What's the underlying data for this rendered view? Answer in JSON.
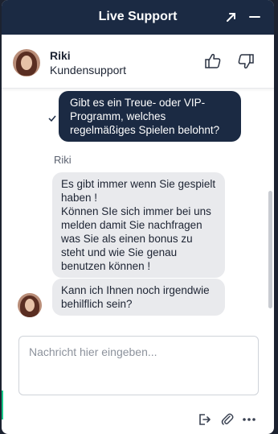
{
  "window": {
    "title": "Live Support",
    "popout_icon": "arrow-up-right-icon",
    "minimize_icon": "minimize-icon"
  },
  "agent": {
    "name": "Riki",
    "role": "Kundensupport",
    "thumbs_up_icon": "thumbs-up-icon",
    "thumbs_down_icon": "thumbs-down-icon"
  },
  "conversation": {
    "user_message": "Gibt es ein Treue- oder VIP-Programm, welches regelmäßiges Spielen belohnt?",
    "sender_label": "Riki",
    "agent_messages": [
      "Es gibt immer wenn Sie gespielt haben !\nKönnen SIe sich immer bei uns melden damit Sie nachfragen was Sie als einen bonus zu steht und wie Sie genau benutzen können !",
      "Kann ich Ihnen noch irgendwie behilflich sein?"
    ]
  },
  "composer": {
    "placeholder": "Nachricht hier eingeben...",
    "value": ""
  },
  "toolbar": {
    "icons": [
      "exit-icon",
      "paperclip-icon",
      "more-icon"
    ]
  },
  "colors": {
    "header": "#1b2a43",
    "user_bubble": "#1b2a43",
    "agent_bubble": "#e9eaed",
    "accent": "#19c98a"
  }
}
